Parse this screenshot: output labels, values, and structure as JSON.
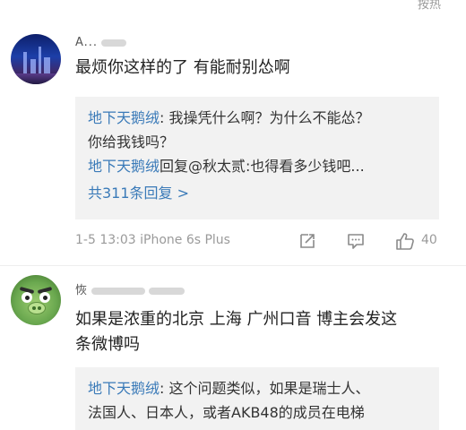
{
  "top_right_text": "按热",
  "comments": [
    {
      "username": "A...",
      "text": "最烦你这样的了 有能耐别怂啊",
      "replies": [
        {
          "author": "地下天鹅绒",
          "text": ": 我操凭什么啊？为什么不能怂？"
        },
        {
          "author": "",
          "text": "你给我钱吗？"
        },
        {
          "author": "地下天鹅绒",
          "text": "回复@秋太贰:也得看多少钱吧..."
        }
      ],
      "more_replies": "共311条回复 >",
      "meta": "1-5 13:03 iPhone 6s Plus",
      "like_count": "40",
      "icons": {
        "share": "share-icon",
        "comment": "comment-icon",
        "like": "like-icon"
      }
    },
    {
      "username": "恢",
      "text_line1": "如果是浓重的北京 上海 广州口音 博主会发这",
      "text_line2": "条微博吗",
      "replies": [
        {
          "author": "地下天鹅绒",
          "text": ": 这个问题类似，如果是瑞士人、"
        },
        {
          "author": "",
          "text": "法国人、日本人，或者AKB48的成员在电梯"
        }
      ]
    }
  ]
}
